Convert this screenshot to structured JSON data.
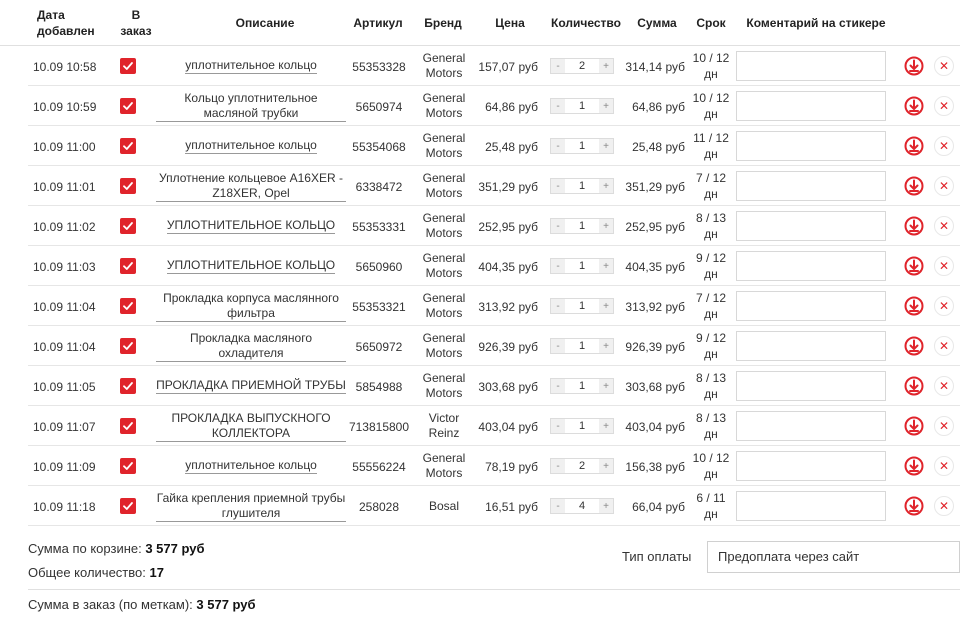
{
  "headers": {
    "date": "Дата добавлен",
    "order": "В заказ",
    "description": "Описание",
    "article": "Артикул",
    "brand": "Бренд",
    "price": "Цена",
    "quantity": "Количество",
    "sum": "Сумма",
    "term": "Срок",
    "comment": "Коментарий на стикере"
  },
  "qty_minus": "-",
  "qty_plus": "+",
  "delete_symbol": "✕",
  "rows": [
    {
      "date": "10.09 10:58",
      "desc": "уплотнительное кольцо",
      "article": "55353328",
      "brand": "General Motors",
      "price": "157,07  руб",
      "qty": "2",
      "sum": "314,14  руб",
      "term": "10 / 12 дн"
    },
    {
      "date": "10.09 10:59",
      "desc": "Кольцо уплотнительное масляной трубки",
      "article": "5650974",
      "brand": "General Motors",
      "price": "64,86  руб",
      "qty": "1",
      "sum": "64,86  руб",
      "term": "10 / 12 дн"
    },
    {
      "date": "10.09 11:00",
      "desc": "уплотнительное кольцо",
      "article": "55354068",
      "brand": "General Motors",
      "price": "25,48  руб",
      "qty": "1",
      "sum": "25,48  руб",
      "term": "11 / 12 дн"
    },
    {
      "date": "10.09 11:01",
      "desc": "Уплотнение кольцевое A16XER - Z18XER, Opel",
      "article": "6338472",
      "brand": "General Motors",
      "price": "351,29  руб",
      "qty": "1",
      "sum": "351,29  руб",
      "term": "7 / 12 дн"
    },
    {
      "date": "10.09 11:02",
      "desc": "УПЛОТНИТЕЛЬНОЕ КОЛЬЦО",
      "article": "55353331",
      "brand": "General Motors",
      "price": "252,95  руб",
      "qty": "1",
      "sum": "252,95  руб",
      "term": "8 / 13 дн"
    },
    {
      "date": "10.09 11:03",
      "desc": "УПЛОТНИТЕЛЬНОЕ КОЛЬЦО",
      "article": "5650960",
      "brand": "General Motors",
      "price": "404,35  руб",
      "qty": "1",
      "sum": "404,35  руб",
      "term": "9 / 12 дн"
    },
    {
      "date": "10.09 11:04",
      "desc": "Прокладка корпуса маслянного фильтра",
      "article": "55353321",
      "brand": "General Motors",
      "price": "313,92  руб",
      "qty": "1",
      "sum": "313,92  руб",
      "term": "7 / 12 дн"
    },
    {
      "date": "10.09 11:04",
      "desc": "Прокладка масляного охладителя",
      "article": "5650972",
      "brand": "General Motors",
      "price": "926,39  руб",
      "qty": "1",
      "sum": "926,39  руб",
      "term": "9 / 12 дн"
    },
    {
      "date": "10.09 11:05",
      "desc": "ПРОКЛАДКА ПРИЕМНОЙ ТРУБЫ",
      "article": "5854988",
      "brand": "General Motors",
      "price": "303,68  руб",
      "qty": "1",
      "sum": "303,68  руб",
      "term": "8 / 13 дн"
    },
    {
      "date": "10.09 11:07",
      "desc": "ПРОКЛАДКА ВЫПУСКНОГО КОЛЛЕКТОРА",
      "article": "713815800",
      "brand": "Victor Reinz",
      "price": "403,04  руб",
      "qty": "1",
      "sum": "403,04  руб",
      "term": "8 / 13 дн"
    },
    {
      "date": "10.09 11:09",
      "desc": "уплотнительное кольцо",
      "article": "55556224",
      "brand": "General Motors",
      "price": "78,19  руб",
      "qty": "2",
      "sum": "156,38  руб",
      "term": "10 / 12 дн"
    },
    {
      "date": "10.09 11:18",
      "desc": "Гайка крепления приемной трубы глушителя",
      "article": "258028",
      "brand": "Bosal",
      "price": "16,51  руб",
      "qty": "4",
      "sum": "66,04  руб",
      "term": "6 / 11 дн"
    }
  ],
  "footer": {
    "cart_sum_label": "Сумма по корзине: ",
    "cart_sum_value": "3 577  руб",
    "total_qty_label": "Общее количество: ",
    "total_qty_value": "17",
    "order_sum_label": "Сумма в заказ (по меткам): ",
    "order_sum_value": "3 577  руб",
    "payment_label": "Тип оплаты",
    "payment_value": "Предоплата через сайт"
  },
  "colors": {
    "accent": "#e0242b"
  }
}
